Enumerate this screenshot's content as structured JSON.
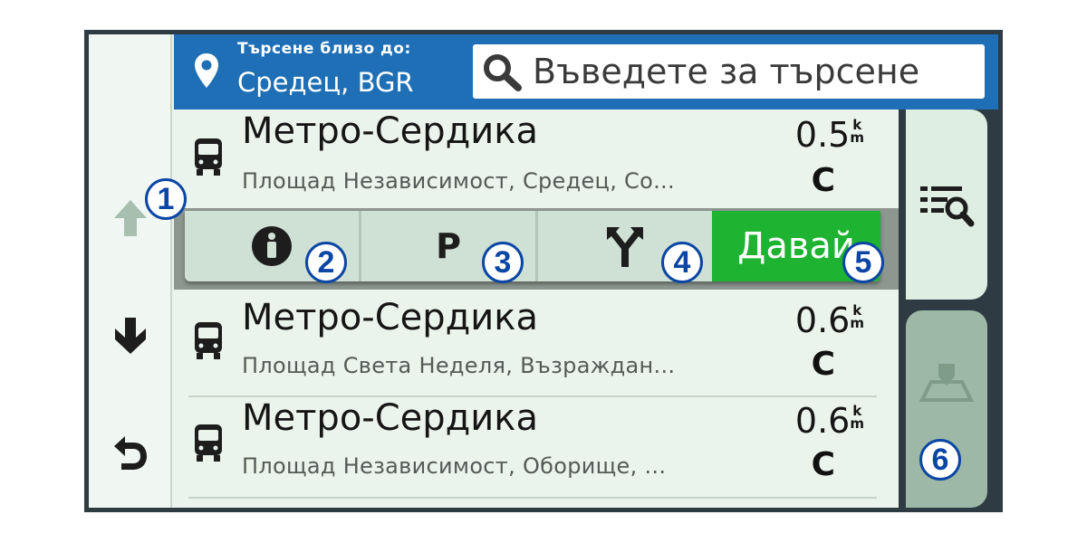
{
  "header": {
    "near_label": "Търсене близо до:",
    "near_value": "Средец, BGR",
    "search_placeholder": "Въведете за търсене"
  },
  "results": [
    {
      "name": "Метро-Сердика",
      "address": "Площад Независимост, Средец, Со...",
      "distance": "0.5",
      "unit_top": "k",
      "unit_bottom": "m",
      "direction": "С",
      "icon": "bus-icon"
    },
    {
      "name": "Метро-Сердика",
      "address": "Площад Света Неделя, Възраждан...",
      "distance": "0.6",
      "unit_top": "k",
      "unit_bottom": "m",
      "direction": "С",
      "icon": "bus-icon"
    },
    {
      "name": "Метро-Сердика",
      "address": "Площад Независимост, Оборище, ...",
      "distance": "0.6",
      "unit_top": "k",
      "unit_bottom": "m",
      "direction": "С",
      "icon": "bus-icon"
    }
  ],
  "actions": {
    "info_icon": "info-icon",
    "parking_label": "P",
    "route_icon": "fork-route-icon",
    "go_label": "Давай"
  },
  "sidebar": {
    "up_icon": "arrow-up-icon",
    "down_icon": "arrow-down-icon",
    "back_icon": "back-icon"
  },
  "right_tabs": {
    "list_search_icon": "list-search-icon",
    "map_pin_icon": "map-pin-icon"
  },
  "callouts": [
    "1",
    "2",
    "3",
    "4",
    "5",
    "6"
  ],
  "colors": {
    "header": "#1e6fb5",
    "go_button": "#1eb331",
    "callout": "#0b46a4"
  }
}
